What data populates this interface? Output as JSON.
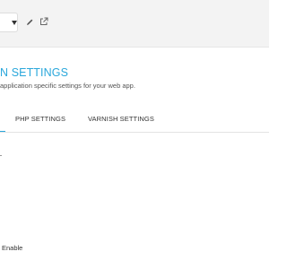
{
  "toolbar": {
    "select_caret_icon": "caret-down-icon",
    "edit_icon": "pencil-icon",
    "external_icon": "external-link-icon"
  },
  "section": {
    "title": "N SETTINGS",
    "description": "application specific settings for your web app."
  },
  "tabs": [
    {
      "label": "",
      "active": true
    },
    {
      "label": "PHP SETTINGS",
      "active": false
    },
    {
      "label": "VARNISH SETTINGS",
      "active": false
    }
  ],
  "form": {
    "enable_label": "Enable"
  },
  "colors": {
    "accent": "#2aa7db",
    "toolbar_bg": "#f3f3f3"
  }
}
